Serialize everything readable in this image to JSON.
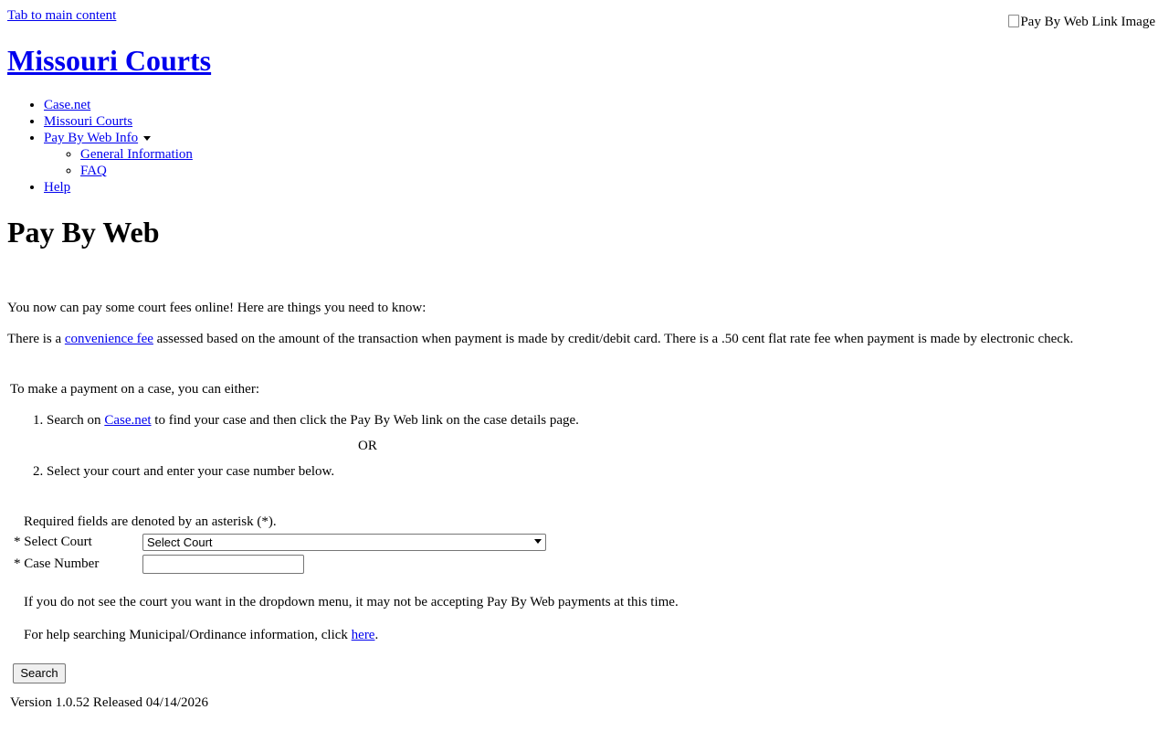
{
  "skip_link": "Tab to main content",
  "header_image_alt": "Pay By Web Link Image",
  "site_title": "Missouri Courts",
  "nav": {
    "casenet": "Case.net",
    "missouri_courts": "Missouri Courts",
    "pay_by_web_info": "Pay By Web Info",
    "general_information": "General Information",
    "faq": "FAQ",
    "help": "Help"
  },
  "page_title": "Pay By Web",
  "intro": "You now can pay some court fees online! Here are things you need to know:",
  "fee": {
    "prefix": "There is a",
    "link": "convenience fee",
    "suffix": "assessed based on the amount of the transaction when payment is made by credit/debit card. There is a .50 cent flat rate fee when payment is made by electronic check."
  },
  "either_text": "To make a payment on a case, you can either:",
  "step1": {
    "prefix": "Search on",
    "link": "Case.net",
    "suffix": "to find your case and then click the Pay By Web link on the case details page."
  },
  "or_text": "OR",
  "step2": "Select your court and enter your case number below.",
  "required_note": "Required fields are denoted by an asterisk (*).",
  "form": {
    "court_label": "* Select Court",
    "court_selected": "Select Court",
    "case_label": "* Case Number",
    "case_value": ""
  },
  "dropdown_note": "If you do not see the court you want in the dropdown menu, it may not be accepting Pay By Web payments at this time.",
  "help_note": {
    "prefix": "For help searching Municipal/Ordinance information, click",
    "link": "here",
    "suffix": "."
  },
  "search_button": "Search",
  "version": "Version 1.0.52 Released 04/14/2026",
  "colors": {
    "link": "#0000ee",
    "text": "#000000",
    "background": "#ffffff"
  }
}
